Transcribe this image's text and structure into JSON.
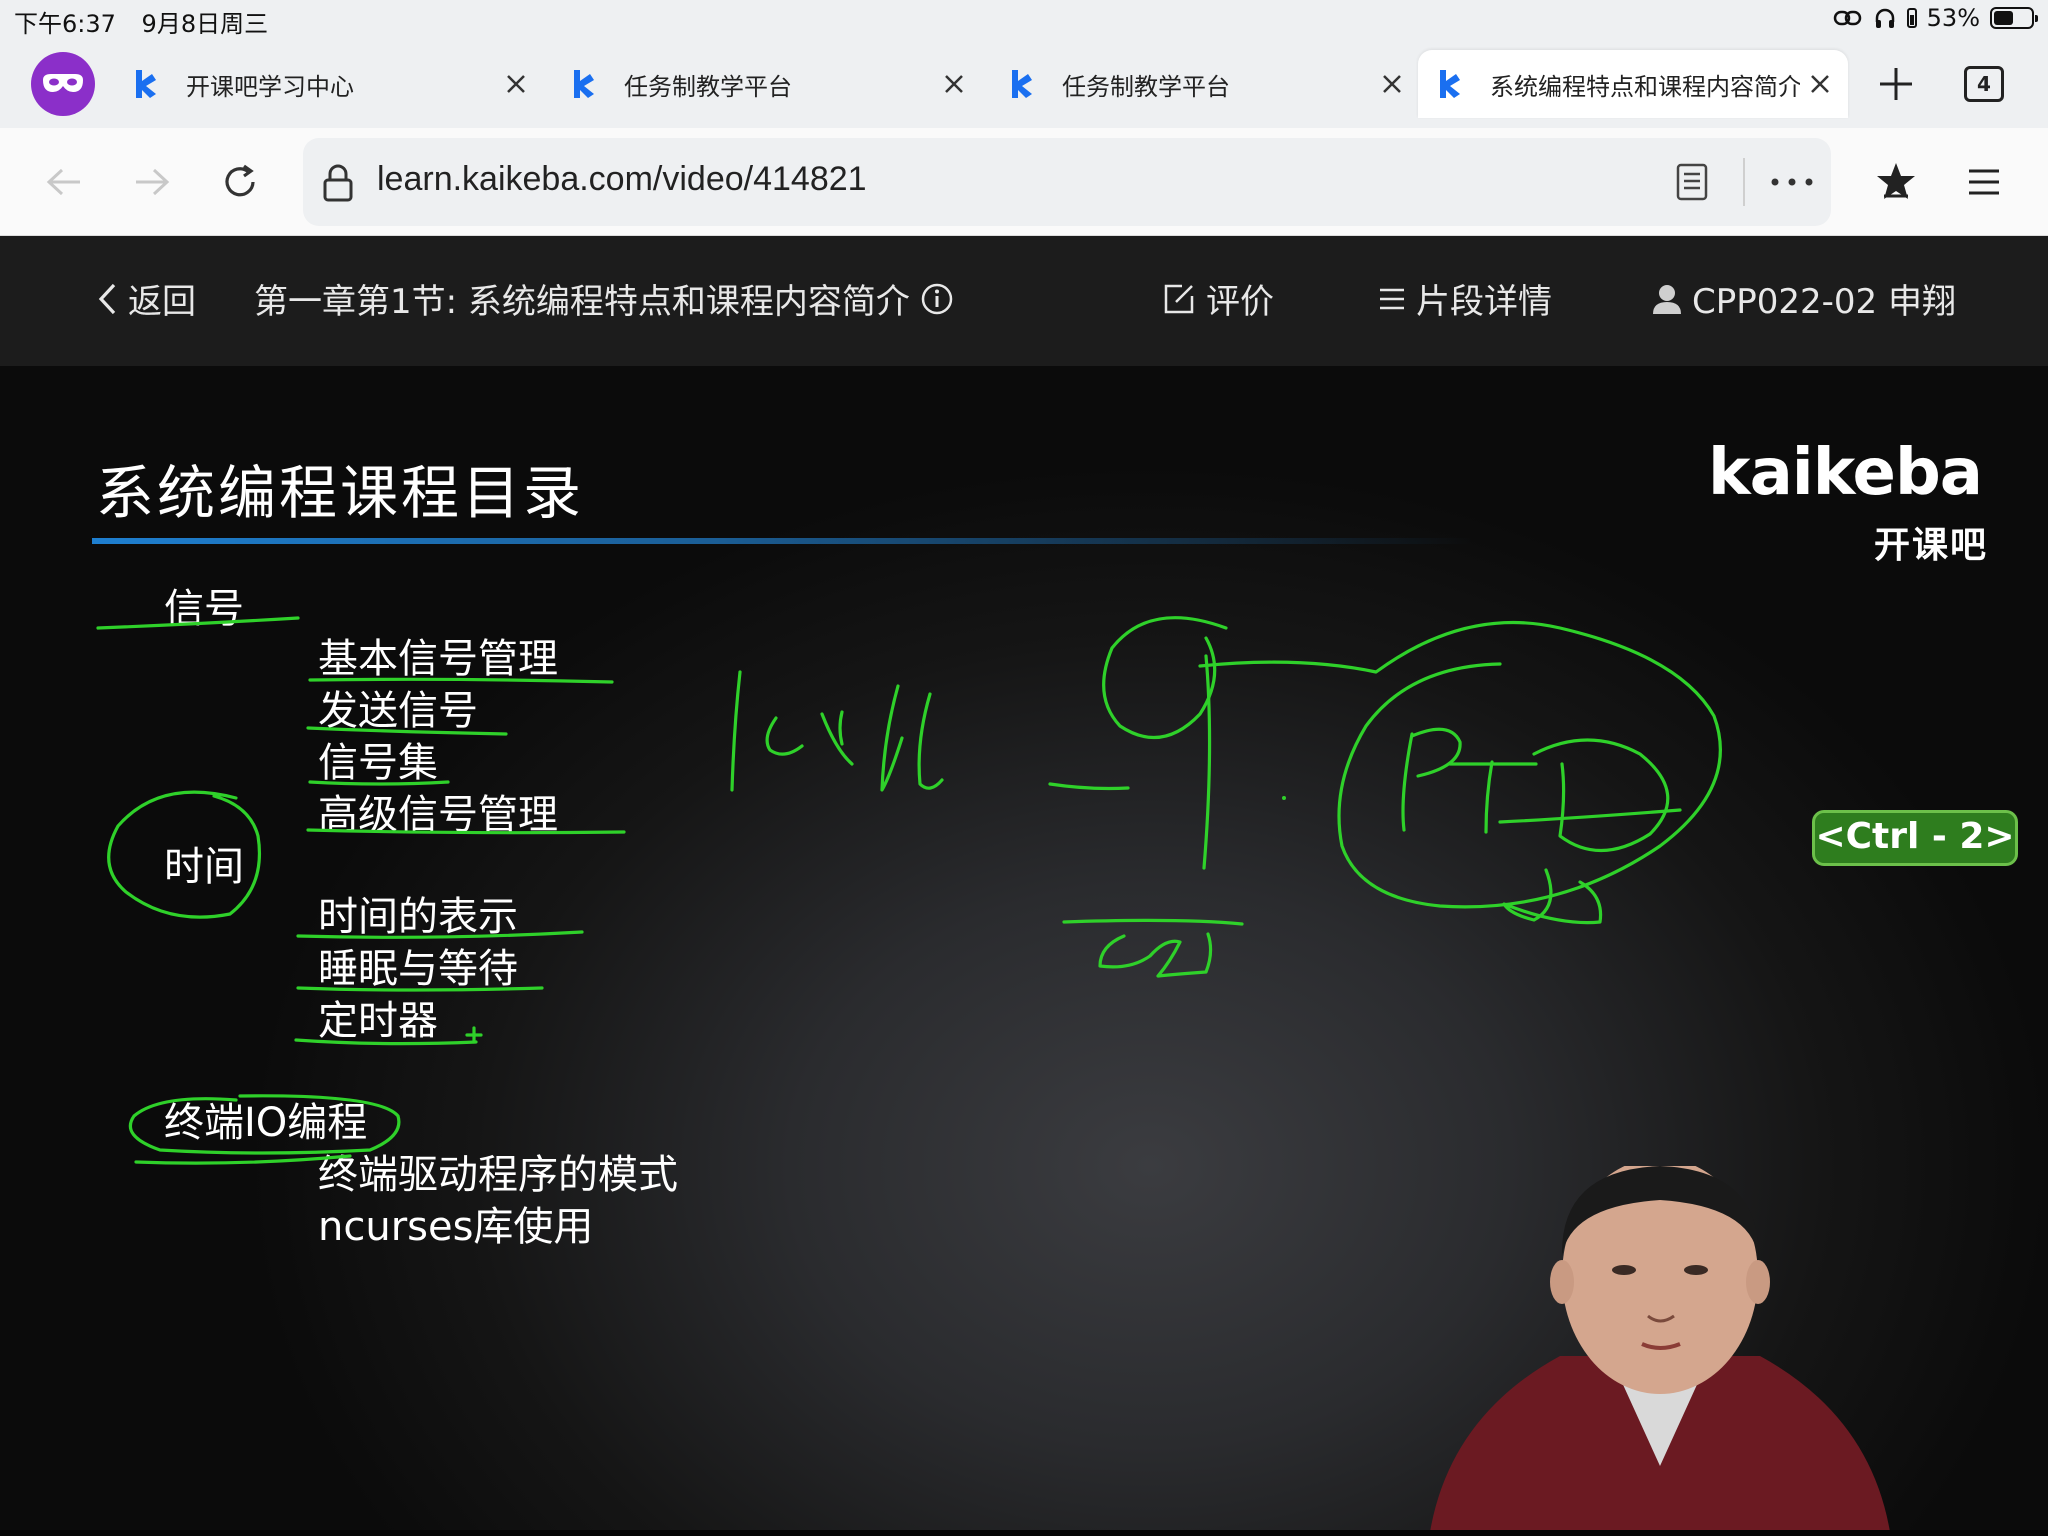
{
  "status_bar": {
    "time": "下午6:37",
    "date": "9月8日周三",
    "battery": "53%",
    "battery_level": 0.53
  },
  "tabs": [
    {
      "title": "开课吧学习中心",
      "active": false
    },
    {
      "title": "任务制教学平台",
      "active": false
    },
    {
      "title": "任务制教学平台",
      "active": false
    },
    {
      "title": "系统编程特点和课程内容简介",
      "active": true
    }
  ],
  "tab_count": "4",
  "address_bar": {
    "url": "learn.kaikeba.com/video/414821"
  },
  "video_header": {
    "back_label": "返回",
    "lesson_title": "第一章第1节:  系统编程特点和课程内容简介",
    "rate_label": "评价",
    "segments_label": "片段详情",
    "user": "CPP022-02 申翔"
  },
  "slide": {
    "title": "系统编程课程目录",
    "logo_word": "kaikeba",
    "logo_sub": "开课吧",
    "sections": [
      {
        "heading": "信号",
        "items": [
          "基本信号管理",
          "发送信号",
          "信号集",
          "高级信号管理"
        ]
      },
      {
        "heading": "时间",
        "items": [
          "时间的表示",
          "睡眠与等待",
          "定时器"
        ]
      },
      {
        "heading": "终端IO编程",
        "items": [
          "终端驱动程序的模式",
          "ncurses库使用"
        ]
      }
    ],
    "shortcut_badge": "<Ctrl - 2>",
    "ink_color": "#2fd12a"
  },
  "colors": {
    "accent_blue": "#1e7fd0",
    "header_bg": "#1c1c1c",
    "browser_chrome": "#eef0f2",
    "tab_icon_blue": "#1a6ff0",
    "avatar_purple": "#8b2fc9"
  }
}
